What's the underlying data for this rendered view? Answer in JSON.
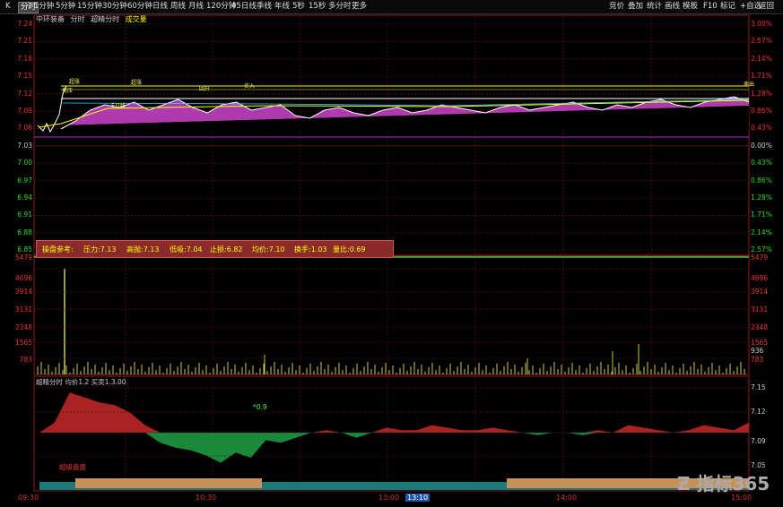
{
  "toolbar": {
    "left_tabs": [
      {
        "key": "k",
        "label": "K"
      },
      {
        "key": "fenshi",
        "label": "分时"
      },
      {
        "key": "m1",
        "label": "1分钟"
      },
      {
        "key": "m5",
        "label": "5分钟"
      },
      {
        "key": "m15",
        "label": "15分钟"
      },
      {
        "key": "m30",
        "label": "30分钟"
      },
      {
        "key": "m60",
        "label": "60分钟"
      },
      {
        "key": "day",
        "label": "日线"
      },
      {
        "key": "week",
        "label": "周线"
      },
      {
        "key": "month",
        "label": "月线"
      },
      {
        "key": "d120",
        "label": "120分钟"
      },
      {
        "key": "d45",
        "label": "45日线"
      },
      {
        "key": "season",
        "label": "季线"
      },
      {
        "key": "year",
        "label": "年线"
      },
      {
        "key": "s5",
        "label": "5秒"
      },
      {
        "key": "s15",
        "label": "15秒"
      },
      {
        "key": "multi",
        "label": "多分时"
      },
      {
        "key": "more",
        "label": "更多"
      }
    ],
    "right_tabs": [
      {
        "key": "bid",
        "label": "竞价"
      },
      {
        "key": "overlay",
        "label": "叠加"
      },
      {
        "key": "stats",
        "label": "统计"
      },
      {
        "key": "draw",
        "label": "画线"
      },
      {
        "key": "tpl",
        "label": "模板"
      },
      {
        "key": "f10",
        "label": "F10"
      },
      {
        "key": "mark",
        "label": "标记"
      },
      {
        "key": "watch",
        "label": "+自选"
      },
      {
        "key": "back",
        "label": "返回"
      }
    ]
  },
  "header": {
    "stock_name": "中环装备",
    "mode": "分时",
    "indicator": "超精分时",
    "volume_label": "成交量"
  },
  "price_axis": {
    "left": [
      "7.24",
      "7.21",
      "7.18",
      "7.15",
      "7.12",
      "7.09",
      "7.06",
      "7.03",
      "7.00",
      "6.97",
      "6.94",
      "6.91",
      "6.88",
      "6.85"
    ],
    "right": [
      "3.00%",
      "2.57%",
      "2.14%",
      "1.71%",
      "1.28%",
      "0.86%",
      "0.43%",
      "0.00%",
      "0.43%",
      "0.86%",
      "1.28%",
      "1.71%",
      "2.14%",
      "2.57%"
    ]
  },
  "price_tags": {
    "high": "7.15",
    "right_tag": "7.13"
  },
  "price_chart_labels": [
    "超涨",
    "超涨",
    "回升",
    "买入",
    "卖出",
    "卖压",
    "5日线"
  ],
  "info_bar": {
    "title": "操盘参考:",
    "items": [
      {
        "label": "压力",
        "value": "7.13"
      },
      {
        "label": "高抛",
        "value": "7.13"
      },
      {
        "label": "低吸",
        "value": "7.04"
      },
      {
        "label": "止损",
        "value": "6.82"
      },
      {
        "label": "均价",
        "value": "7.10"
      },
      {
        "label": "换手",
        "value": "1.03"
      },
      {
        "label": "量比",
        "value": "0.69"
      }
    ]
  },
  "volume_axis": {
    "left": [
      "5479",
      "4696",
      "3914",
      "3131",
      "2348",
      "1565",
      "783"
    ],
    "right": [
      "5479",
      "4696",
      "3914",
      "3131",
      "2348",
      "1565",
      "936",
      "783"
    ]
  },
  "indicator_panel": {
    "title": "超精分时",
    "params": "均价1.2 买卖1.3.00",
    "axis": [
      "7.15",
      "7.12",
      "7.09",
      "7.05"
    ],
    "mid_label": "*0.9",
    "bottom_label": "超级盘面"
  },
  "time_axis": [
    "09:30",
    "10:30",
    "13:00",
    "13:10",
    "14:00",
    "15:00"
  ],
  "watermark": "指标365",
  "colors": {
    "up": "#e33333",
    "down": "#22cc22",
    "price_fill": "#cc44cc",
    "avg_line": "#ffff00",
    "volume": "#ffff66",
    "ind_up": "#aa2222",
    "ind_down": "#1a8a3a"
  }
}
